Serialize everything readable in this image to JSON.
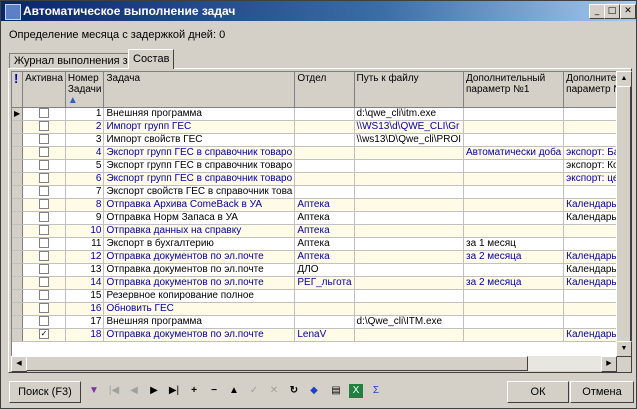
{
  "window": {
    "title": "Автоматическое выполнение задач"
  },
  "info_text": "Определение месяца с задержкой дней: 0",
  "tabs": [
    {
      "label": "Журнал выполнения задач",
      "active": false
    },
    {
      "label": "Состав",
      "active": true
    }
  ],
  "columns": [
    "!",
    "Активна",
    "Номер Задачи",
    "Задача",
    "Отдел",
    "Путь к файлу",
    "Дополнительный параметр №1",
    "Дополнительный параметр №2"
  ],
  "rows": [
    {
      "checked": false,
      "num": "1",
      "task": "Внешняя программа",
      "dept": "",
      "path": "d:\\qwe_cli\\itm.exe",
      "p1": "",
      "p2": "",
      "color": "black"
    },
    {
      "checked": false,
      "num": "2",
      "task": "Импорт групп ГЕС",
      "dept": "",
      "path": "\\\\WS13\\d\\QWE_CLI\\Gr",
      "p1": "",
      "p2": "",
      "color": "blue"
    },
    {
      "checked": false,
      "num": "3",
      "task": "Импорт свойств ГЕС",
      "dept": "",
      "path": "\\\\ws13\\D\\Qwe_cli\\PROI",
      "p1": "",
      "p2": "",
      "color": "black"
    },
    {
      "checked": false,
      "num": "4",
      "task": "Экспорт групп ГЕС в справочник товаро",
      "dept": "",
      "path": "",
      "p1": "Автоматически доба",
      "p2": "экспорт: Базовый",
      "color": "blue"
    },
    {
      "checked": false,
      "num": "5",
      "task": "Экспорт групп ГЕС в справочник товаро",
      "dept": "",
      "path": "",
      "p1": "",
      "p2": "экспорт: Контрол",
      "color": "black"
    },
    {
      "checked": false,
      "num": "6",
      "task": "Экспорт групп ГЕС в справочник товаро",
      "dept": "",
      "path": "",
      "p1": "",
      "p2": "экспорт: целевые",
      "color": "blue"
    },
    {
      "checked": false,
      "num": "7",
      "task": "Экспорт свойств ГЕС в справочник това",
      "dept": "",
      "path": "",
      "p1": "",
      "p2": "",
      "color": "black"
    },
    {
      "checked": false,
      "num": "8",
      "task": "Отправка Архива ComeBack в УА",
      "dept": "Аптека",
      "path": "",
      "p1": "",
      "p2": "Календарь выпол",
      "color": "blue"
    },
    {
      "checked": false,
      "num": "9",
      "task": "Отправка Норм Запаса в УА",
      "dept": "Аптека",
      "path": "",
      "p1": "",
      "p2": "Календарь выпол",
      "color": "black"
    },
    {
      "checked": false,
      "num": "10",
      "task": "Отправка данных на справку",
      "dept": "Аптека",
      "path": "",
      "p1": "",
      "p2": "",
      "color": "blue"
    },
    {
      "checked": false,
      "num": "11",
      "task": "Экспорт в бухгалтерию",
      "dept": "Аптека",
      "path": "",
      "p1": "за 1 месяц",
      "p2": "",
      "color": "black"
    },
    {
      "checked": false,
      "num": "12",
      "task": "Отправка документов по эл.почте",
      "dept": "Аптека",
      "path": "",
      "p1": "за 2 месяца",
      "p2": "Календарь выпол",
      "color": "blue"
    },
    {
      "checked": false,
      "num": "13",
      "task": "Отправка документов по эл.почте",
      "dept": "ДЛО",
      "path": "",
      "p1": "",
      "p2": "Календарь выпол",
      "color": "black"
    },
    {
      "checked": false,
      "num": "14",
      "task": "Отправка документов по эл.почте",
      "dept": "РЕГ_льгота",
      "path": "",
      "p1": "за 2 месяца",
      "p2": "Календарь выпол",
      "color": "blue"
    },
    {
      "checked": false,
      "num": "15",
      "task": "Резервное копирование полное",
      "dept": "",
      "path": "",
      "p1": "",
      "p2": "",
      "color": "black"
    },
    {
      "checked": false,
      "num": "16",
      "task": "Обновить ГЕС",
      "dept": "",
      "path": "",
      "p1": "",
      "p2": "",
      "color": "blue"
    },
    {
      "checked": false,
      "num": "17",
      "task": "Внешняя программа",
      "dept": "",
      "path": "d:\\Qwe_cli\\ITM.exe",
      "p1": "",
      "p2": "",
      "color": "black"
    },
    {
      "checked": true,
      "num": "18",
      "task": "Отправка документов по эл.почте",
      "dept": "LenaV",
      "path": "",
      "p1": "",
      "p2": "Календарь выпол",
      "color": "blue"
    }
  ],
  "footer": {
    "search_label": "Поиск (F3)",
    "ok_label": "ОК",
    "cancel_label": "Отмена"
  },
  "toolbar_icons": [
    "filter-icon",
    "first-record-icon",
    "prior-record-icon",
    "next-record-icon",
    "last-record-icon",
    "insert-record-icon",
    "delete-record-icon",
    "edit-record-icon",
    "post-edit-icon",
    "cancel-edit-icon",
    "refresh-icon",
    "bookmark-icon",
    "print-icon",
    "excel-export-icon",
    "sum-icon"
  ]
}
